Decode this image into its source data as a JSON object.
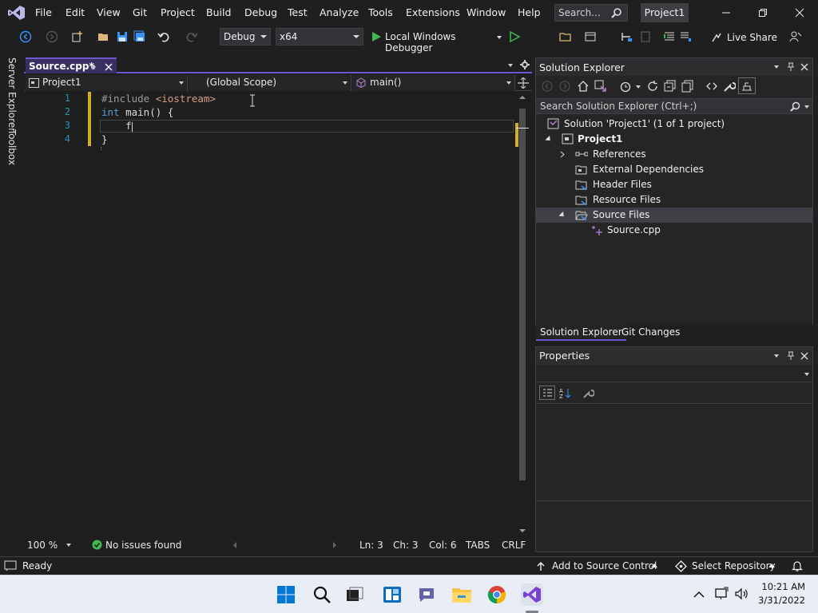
{
  "menu": [
    "File",
    "Edit",
    "View",
    "Git",
    "Project",
    "Build",
    "Debug",
    "Test",
    "Analyze",
    "Tools",
    "Extensions",
    "Window",
    "Help"
  ],
  "search": {
    "placeholder": "Search..."
  },
  "project_title": "Project1",
  "toolbar": {
    "config": "Debug",
    "platform": "x64",
    "debugger": "Local Windows Debugger",
    "live_share": "Live Share"
  },
  "left_strip": [
    "Server Explorer",
    "Toolbox"
  ],
  "document_tab": {
    "label": "Source.cpp*"
  },
  "nav_bar": {
    "project": "Project1",
    "scope": "(Global Scope)",
    "member": "main()"
  },
  "code_lines": [
    {
      "no": "1",
      "text": "#include <iostream>"
    },
    {
      "no": "2",
      "text": "int main() {"
    },
    {
      "no": "3",
      "text": "    f"
    },
    {
      "no": "4",
      "text": "}"
    }
  ],
  "editor_status": {
    "zoom": "100 %",
    "issues": "No issues found",
    "ln": "Ln: 3",
    "ch": "Ch: 3",
    "col": "Col: 6",
    "tabs": "TABS",
    "crlf": "CRLF"
  },
  "solution_explorer": {
    "title": "Solution Explorer",
    "search_placeholder": "Search Solution Explorer (Ctrl+;)",
    "tree": [
      {
        "label": "Solution 'Project1' (1 of 1 project)",
        "icon": "solution-icon"
      },
      {
        "label": "Project1",
        "icon": "project-icon"
      },
      {
        "label": "References",
        "icon": "references-icon"
      },
      {
        "label": "External Dependencies",
        "icon": "folder-icon"
      },
      {
        "label": "Header Files",
        "icon": "folder-icon"
      },
      {
        "label": "Resource Files",
        "icon": "folder-icon"
      },
      {
        "label": "Source Files",
        "icon": "folder-open-icon"
      },
      {
        "label": "Source.cpp",
        "icon": "cpp-file-icon"
      }
    ]
  },
  "bottom_tabs": [
    "Solution Explorer",
    "Git Changes"
  ],
  "properties": {
    "title": "Properties"
  },
  "statusbar": {
    "ready": "Ready",
    "add_source_control": "Add to Source Control",
    "select_repo": "Select Repository"
  },
  "clock": {
    "time": "10:21 AM",
    "date": "3/31/2022"
  },
  "colors": {
    "accent": "#6e56cf",
    "change_bar": "#cfb023",
    "line_number": "#2b91af",
    "keyword": "#569cd6"
  }
}
